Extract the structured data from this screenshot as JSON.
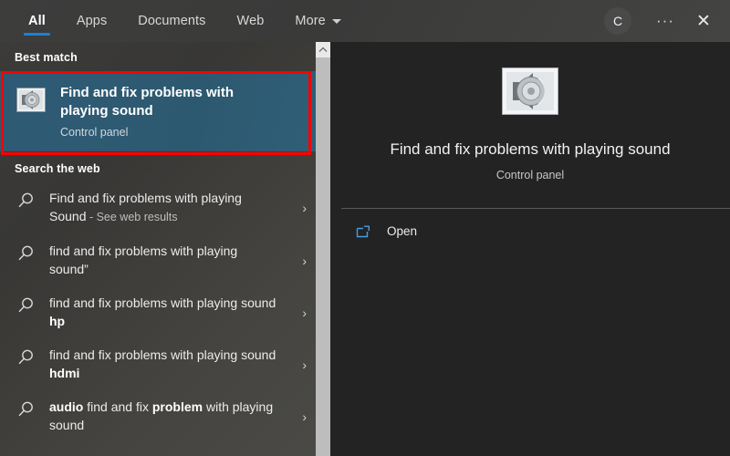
{
  "window": {
    "title": "Windows Search",
    "accent_color": "#1e7fd4",
    "highlight_color": "#ff0000",
    "best_match_bg": "#2e5a75"
  },
  "topbar": {
    "tabs": [
      {
        "label": "All",
        "active": true
      },
      {
        "label": "Apps",
        "active": false
      },
      {
        "label": "Documents",
        "active": false
      },
      {
        "label": "Web",
        "active": false
      },
      {
        "label": "More",
        "active": false,
        "has_caret": true
      }
    ],
    "avatar_initial": "C",
    "more_options_label": "···",
    "close_label": "✕"
  },
  "left_pane": {
    "best_match_heading": "Best match",
    "best_match": {
      "title": "Find and fix problems with playing sound",
      "subtitle": "Control panel",
      "icon": "sound-speaker-icon",
      "highlighted": true
    },
    "web_heading": "Search the web",
    "results": [
      {
        "icon": "search-icon",
        "text_main": "Find and fix problems with playing Sound",
        "text_suffix": " - See web results",
        "bold_prefix": "",
        "bold_inline": "",
        "chevron": "›"
      },
      {
        "icon": "search-icon",
        "text_main": "find and fix problems with playing sound”",
        "text_suffix": "",
        "bold_prefix": "",
        "bold_inline": "",
        "chevron": "›"
      },
      {
        "icon": "search-icon",
        "text_main": "find and fix problems with playing sound ",
        "text_suffix": "",
        "bold_prefix": "",
        "bold_inline": "hp",
        "chevron": "›"
      },
      {
        "icon": "search-icon",
        "text_main": "find and fix problems with playing sound ",
        "text_suffix": "",
        "bold_prefix": "",
        "bold_inline": "hdmi",
        "chevron": "›"
      },
      {
        "icon": "search-icon",
        "text_main": " find and fix ",
        "text_suffix": " with playing sound",
        "bold_prefix": "audio",
        "bold_inline": "problem",
        "chevron": "›"
      }
    ],
    "scrollbar": {
      "up_arrow": "scroll-up-icon",
      "thumb_visible": true
    }
  },
  "preview": {
    "icon": "sound-speaker-icon",
    "title": "Find and fix problems with playing sound",
    "subtitle": "Control panel",
    "actions": [
      {
        "icon": "open-external-icon",
        "label": "Open"
      }
    ]
  }
}
